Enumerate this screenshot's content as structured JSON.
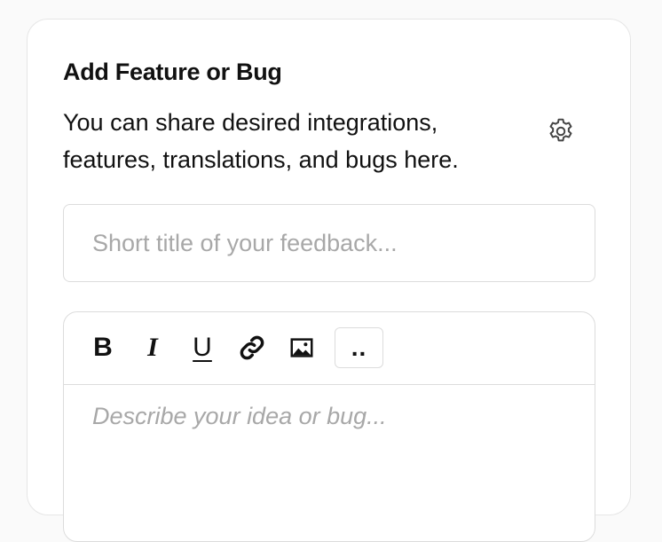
{
  "form": {
    "title": "Add Feature or Bug",
    "description": "You can share desired integrations, features, translations, and bugs here.",
    "title_input": {
      "value": "",
      "placeholder": "Short title of your feedback..."
    },
    "editor": {
      "toolbar": {
        "bold": "B",
        "italic": "I",
        "underline": "U",
        "link_icon": "link-icon",
        "image_icon": "image-icon",
        "more": ".."
      },
      "placeholder": "Describe your idea or bug..."
    },
    "settings_icon": "gear-icon"
  }
}
